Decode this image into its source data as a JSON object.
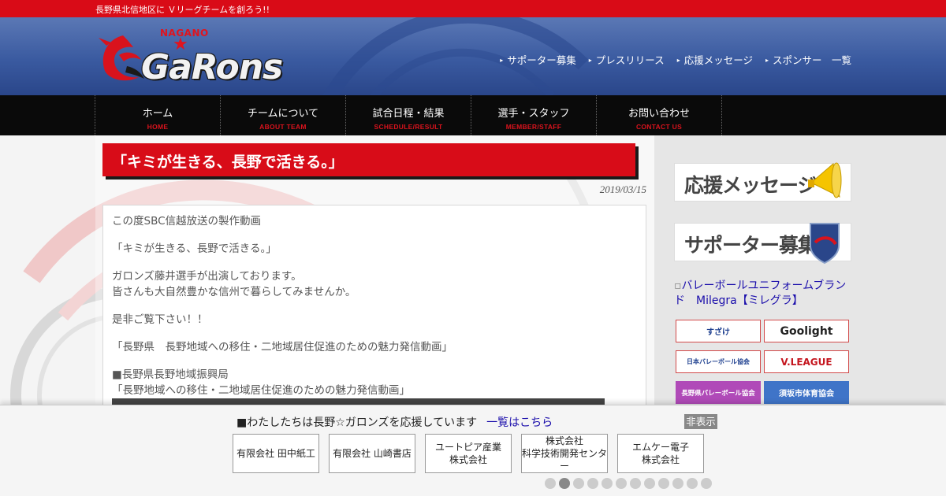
{
  "topbar": {
    "tagline": "長野県北信地区に Ｖリーグチームを創ろう!!"
  },
  "logo": {
    "small": "NAGANO",
    "star": "★",
    "word": "GaRons"
  },
  "header_links": [
    {
      "label": "サポーター募集"
    },
    {
      "label": "プレスリリース"
    },
    {
      "label": "応援メッセージ"
    },
    {
      "label": "スポンサー　一覧"
    }
  ],
  "nav": [
    {
      "jp": "ホーム",
      "en": "HOME"
    },
    {
      "jp": "チームについて",
      "en": "ABOUT TEAM"
    },
    {
      "jp": "試合日程・結果",
      "en": "SCHEDULE/RESULT"
    },
    {
      "jp": "選手・スタッフ",
      "en": "MEMBER/STAFF"
    },
    {
      "jp": "お問い合わせ",
      "en": "CONTACT US"
    }
  ],
  "post": {
    "title": "「キミが生きる、長野で活きる。」",
    "date": "2019/03/15",
    "lines": [
      "この度SBC信越放送の製作動画",
      "「キミが生きる、長野で活きる。」",
      "ガロンズ藤井選手が出演しております。",
      "皆さんも大自然豊かな信州で暮らしてみませんか。",
      "是非ご覧下さい！！",
      "「長野県　長野地域への移住・二地域居住促進のための魅力発信動画」",
      "■長野県長野地域振興局",
      "「長野地域への移住・二地域居住促進のための魅力発信動画」"
    ]
  },
  "sidebar": {
    "message_banner": "応援メッセージ",
    "supporter_banner": "サポーター募集",
    "uniform_link": "バレーボールユニフォームブランド　Milegra【ミレグラ】",
    "logos": [
      {
        "label": "すざけ",
        "color": "#1d3f8f"
      },
      {
        "label": "Goolight",
        "color": "#222222"
      },
      {
        "label": "日本バレーボール協会",
        "color": "#1d3f8f"
      },
      {
        "label": "V.LEAGUE",
        "color": "#c4141d"
      },
      {
        "label": "長野県バレーボール協会",
        "color": "#ffffff"
      },
      {
        "label": "須坂市体育協会",
        "color": "#ffffff"
      }
    ]
  },
  "sponsors": {
    "heading": "■わたしたちは長野☆ガロンズを応援しています",
    "more": "一覧はこちら",
    "hide": "非表示",
    "cards": [
      {
        "line1": "有限会社 田中紙工",
        "line2": ""
      },
      {
        "line1": "有限会社 山崎書店",
        "line2": ""
      },
      {
        "line1": "ユートピア産業",
        "line2": "株式会社"
      },
      {
        "line1": "株式会社",
        "line2": "科学技術開発センター"
      },
      {
        "line1": "エムケー電子",
        "line2": "株式会社"
      }
    ],
    "page_count": 12,
    "current_page": 2
  },
  "colors": {
    "red": "#d80c18",
    "navy": "#2a468a",
    "black": "#0a0a0a"
  }
}
